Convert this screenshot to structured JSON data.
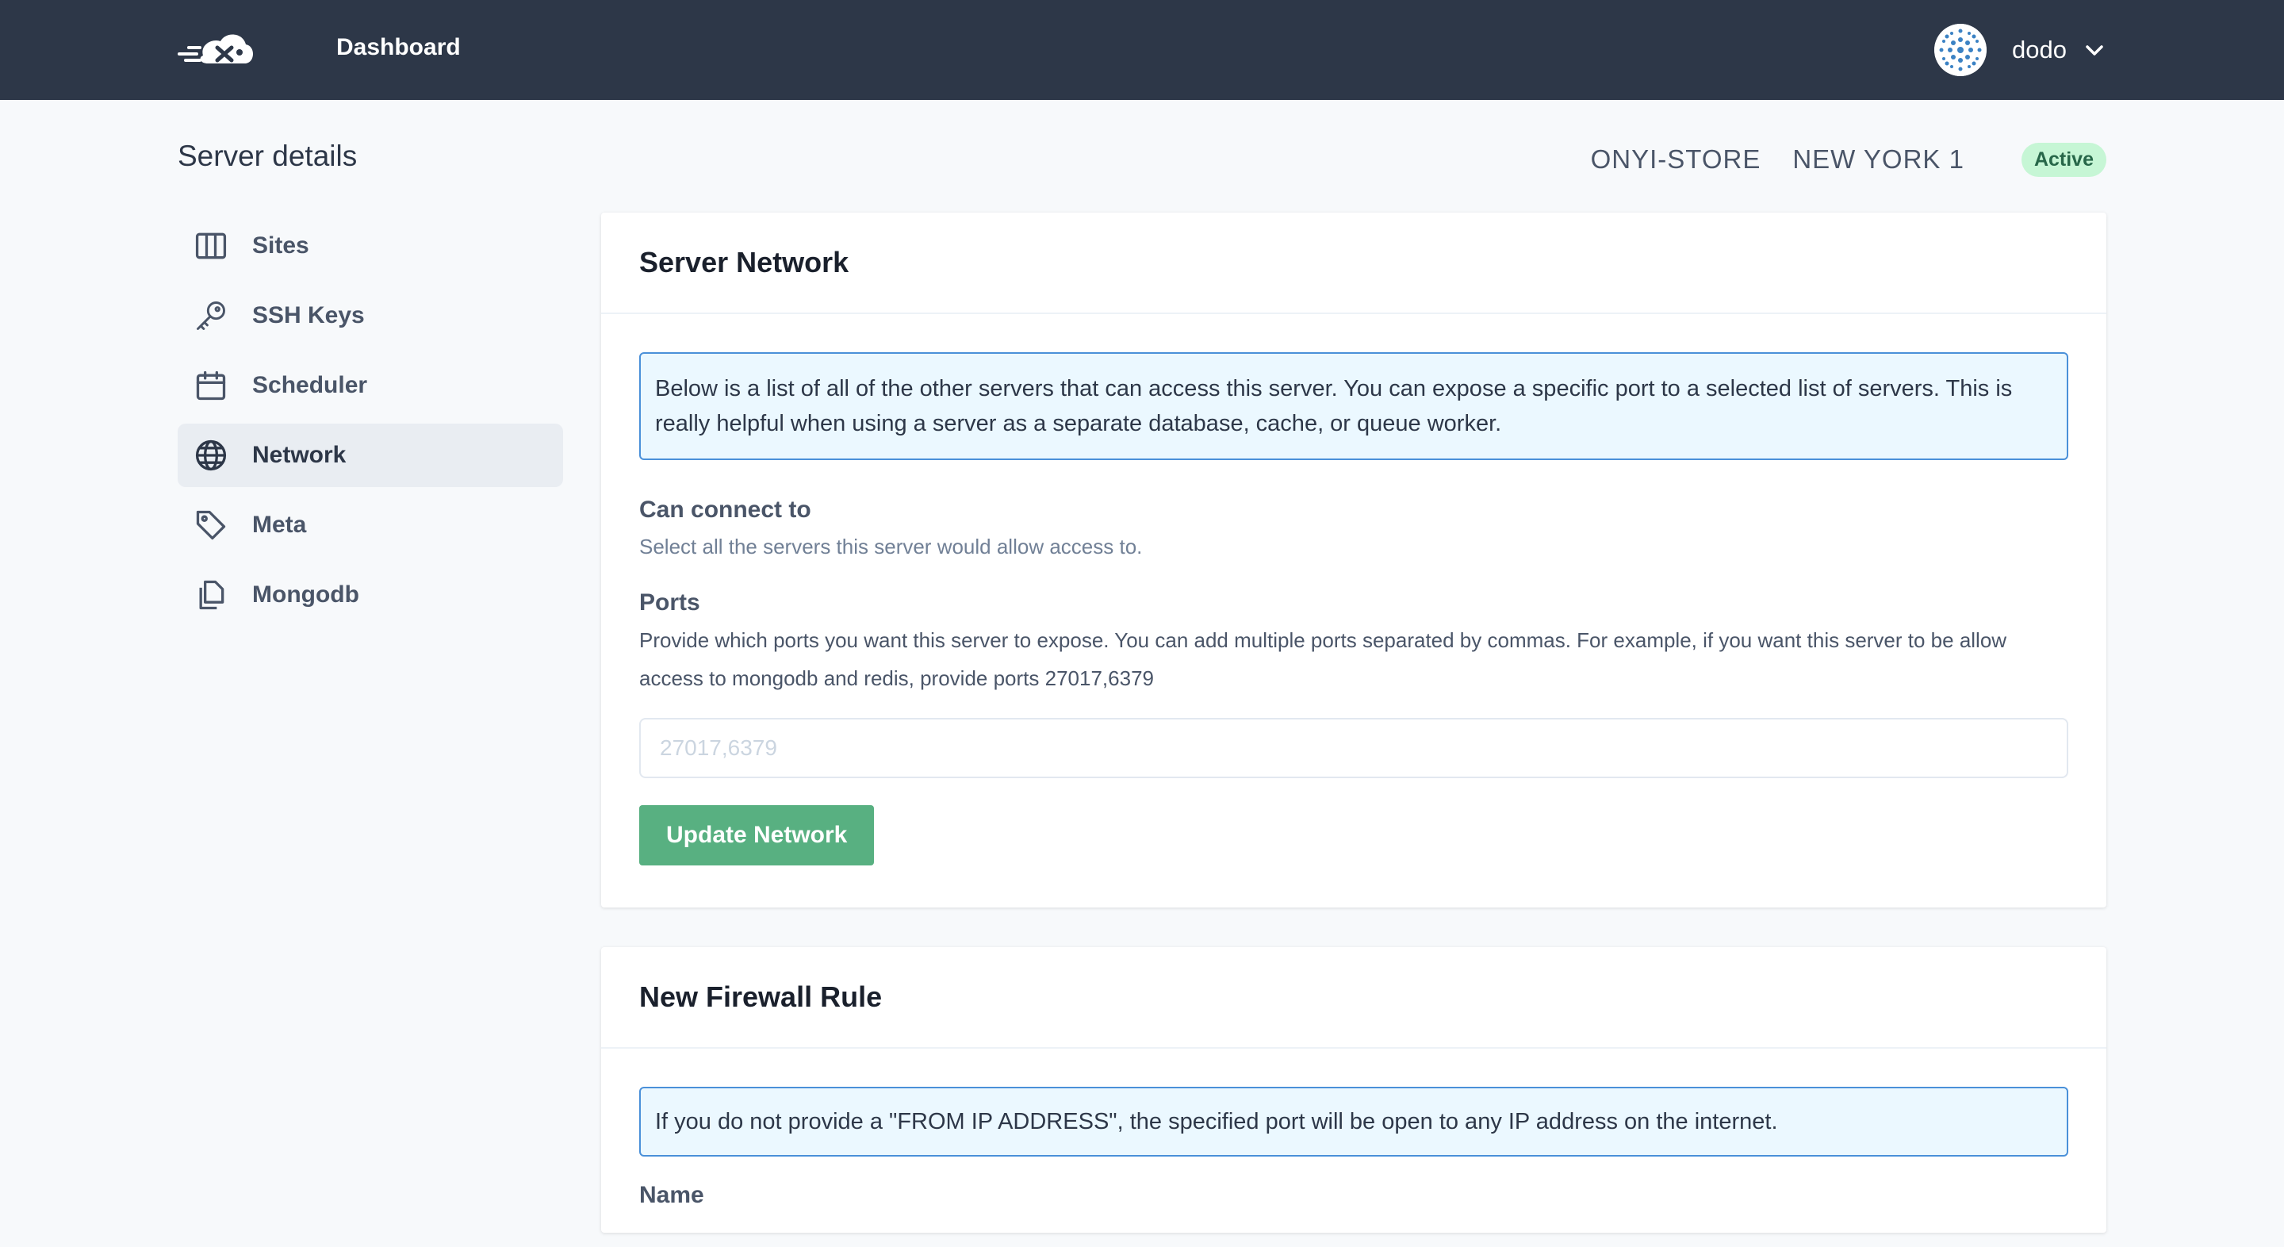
{
  "topbar": {
    "logo_icon": "cloud-rocket-logo",
    "nav_dashboard": "Dashboard",
    "user": {
      "name": "dodo",
      "avatar_icon": "user-avatar",
      "menu_icon": "chevron-down-icon"
    }
  },
  "header": {
    "title": "Server details",
    "server_name": "ONYI-STORE",
    "region": "NEW YORK 1",
    "status": "Active"
  },
  "sidebar": {
    "items": [
      {
        "label": "Sites",
        "icon": "columns-icon",
        "active": false
      },
      {
        "label": "SSH Keys",
        "icon": "key-icon",
        "active": false
      },
      {
        "label": "Scheduler",
        "icon": "calendar-icon",
        "active": false
      },
      {
        "label": "Network",
        "icon": "globe-icon",
        "active": true
      },
      {
        "label": "Meta",
        "icon": "tag-icon",
        "active": false
      },
      {
        "label": "Mongodb",
        "icon": "copy-icon",
        "active": false
      }
    ]
  },
  "network_card": {
    "title": "Server Network",
    "info": "Below is a list of all of the other servers that can access this server. You can expose a specific port to a selected list of servers. This is really helpful when using a server as a separate database, cache, or queue worker.",
    "connect_label": "Can connect to",
    "connect_help": "Select all the servers this server would allow access to.",
    "ports_label": "Ports",
    "ports_help": "Provide which ports you want this server to expose. You can add multiple ports separated by commas. For example, if you want this server to be allow access to mongodb and redis, provide ports 27017,6379",
    "ports_value": "",
    "ports_placeholder": "27017,6379",
    "submit_label": "Update Network"
  },
  "firewall_card": {
    "title": "New Firewall Rule",
    "info": "If you do not provide a \"FROM IP ADDRESS\", the specified port will be open to any IP address on the internet.",
    "name_label": "Name"
  },
  "colors": {
    "topbar": "#2d3748",
    "accent_button": "#58b081",
    "badge_bg": "#c6f6d5",
    "badge_text": "#276749",
    "info_border": "#4a90d9",
    "info_bg": "#ebf8ff"
  }
}
